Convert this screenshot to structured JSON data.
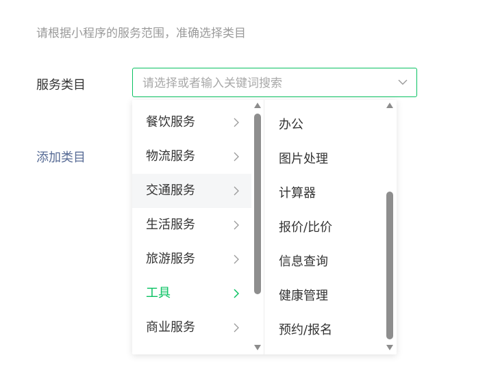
{
  "hint": "请根据小程序的服务范围，准确选择类目",
  "field_label": "服务类目",
  "search": {
    "placeholder": "请选择或者输入关键词搜索",
    "value": ""
  },
  "add_link": "添加类目",
  "colors": {
    "accent": "#07c160",
    "link": "#576b95"
  },
  "left_column": {
    "items": [
      {
        "label": "餐饮服务",
        "state": "normal"
      },
      {
        "label": "物流服务",
        "state": "normal"
      },
      {
        "label": "交通服务",
        "state": "hover"
      },
      {
        "label": "生活服务",
        "state": "normal"
      },
      {
        "label": "旅游服务",
        "state": "normal"
      },
      {
        "label": "工具",
        "state": "active"
      },
      {
        "label": "商业服务",
        "state": "normal"
      }
    ]
  },
  "right_column": {
    "items": [
      {
        "label": "办公"
      },
      {
        "label": "图片处理"
      },
      {
        "label": "计算器"
      },
      {
        "label": "报价/比价"
      },
      {
        "label": "信息查询"
      },
      {
        "label": "健康管理"
      },
      {
        "label": "预约/报名"
      }
    ]
  }
}
